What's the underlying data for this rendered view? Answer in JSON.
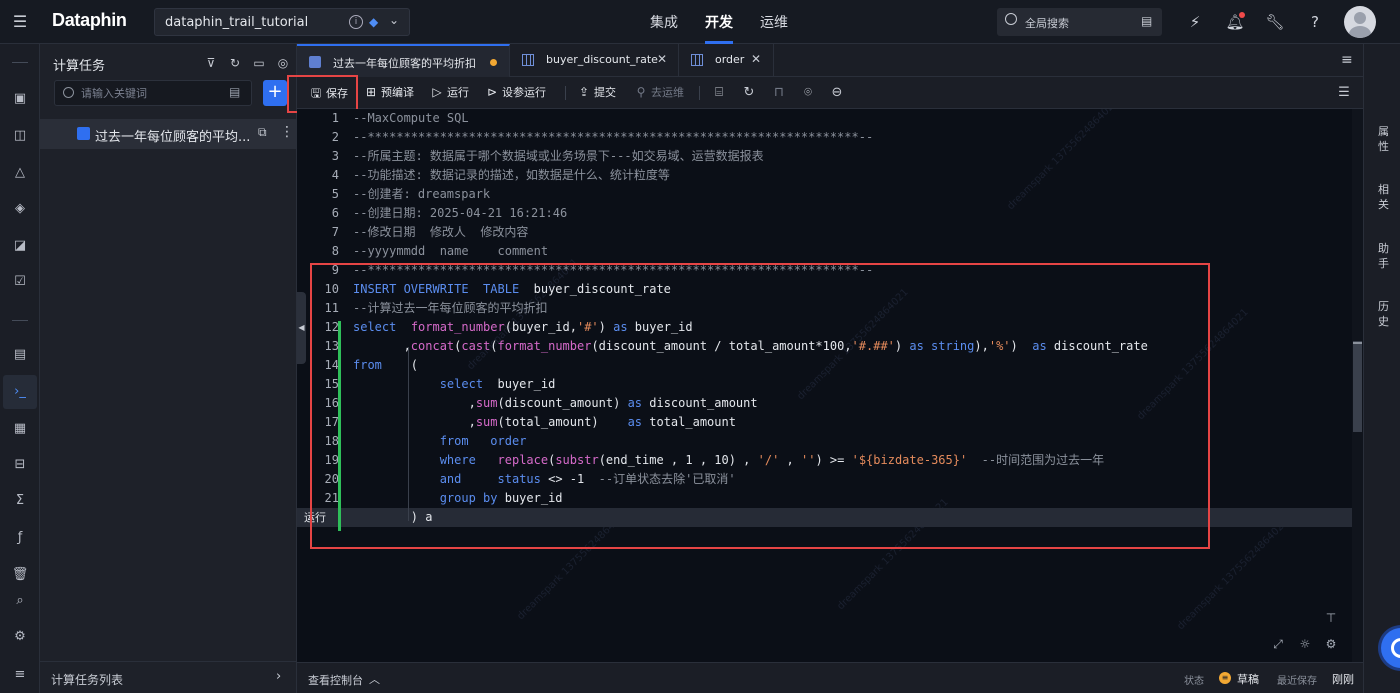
{
  "app": {
    "logo": "Dataphin",
    "project": "dataphin_trail_tutorial",
    "nav_tabs": [
      "集成",
      "开发",
      "运维"
    ],
    "active_nav": "开发",
    "global_search_placeholder": "全局搜索"
  },
  "task_panel": {
    "title": "计算任务",
    "search_placeholder": "请输入关键词",
    "task_item_label": "过去一年每位顾客的平均...",
    "footer_label": "计算任务列表"
  },
  "tabs": [
    {
      "label": "过去一年每位顾客的平均折扣",
      "icon": "sql-file-icon",
      "modified": true,
      "active": true
    },
    {
      "label": "buyer_discount_rate",
      "icon": "table-icon",
      "modified": false,
      "active": false
    },
    {
      "label": "order",
      "icon": "table-icon",
      "modified": false,
      "active": false
    }
  ],
  "toolbar": {
    "save": "保存",
    "precompile": "预编译",
    "run": "运行",
    "param_run": "设参运行",
    "submit": "提交",
    "to_ops": "去运维"
  },
  "editor": {
    "run_tag": "运行",
    "lines": [
      {
        "n": "1",
        "tokens": [
          {
            "c": "cm",
            "t": "--MaxCompute SQL"
          }
        ]
      },
      {
        "n": "2",
        "tokens": [
          {
            "c": "cm",
            "t": "--********************************************************************--"
          }
        ]
      },
      {
        "n": "3",
        "tokens": [
          {
            "c": "cm",
            "t": "--所属主题: 数据属于哪个数据域或业务场景下---如交易域、运营数据报表"
          }
        ]
      },
      {
        "n": "4",
        "tokens": [
          {
            "c": "cm",
            "t": "--功能描述: 数据记录的描述，如数据是什么、统计粒度等"
          }
        ]
      },
      {
        "n": "5",
        "tokens": [
          {
            "c": "cm",
            "t": "--创建者: dreamspark"
          }
        ]
      },
      {
        "n": "6",
        "tokens": [
          {
            "c": "cm",
            "t": "--创建日期: 2025-04-21 16:21:46"
          }
        ]
      },
      {
        "n": "7",
        "tokens": [
          {
            "c": "cm",
            "t": "--修改日期  修改人  修改内容"
          }
        ]
      },
      {
        "n": "8",
        "tokens": [
          {
            "c": "cm",
            "t": "--yyyymmdd  name    comment"
          }
        ]
      },
      {
        "n": "9",
        "tokens": [
          {
            "c": "cm",
            "t": "--********************************************************************--"
          }
        ]
      },
      {
        "n": "10",
        "tokens": [
          {
            "c": "kw",
            "t": "INSERT OVERWRITE  TABLE"
          },
          {
            "c": "tx",
            "t": "  buyer_discount_rate"
          }
        ]
      },
      {
        "n": "11",
        "tokens": [
          {
            "c": "cm",
            "t": "--计算过去一年每位顾客的平均折扣"
          }
        ]
      },
      {
        "n": "12",
        "tokens": [
          {
            "c": "kw",
            "t": "select"
          },
          {
            "c": "tx",
            "t": "  "
          },
          {
            "c": "fn",
            "t": "format_number"
          },
          {
            "c": "tx",
            "t": "(buyer_id,"
          },
          {
            "c": "st",
            "t": "'#'"
          },
          {
            "c": "tx",
            "t": ") "
          },
          {
            "c": "kw",
            "t": "as"
          },
          {
            "c": "tx",
            "t": " buyer_id"
          }
        ]
      },
      {
        "n": "13",
        "tokens": [
          {
            "c": "tx",
            "t": "       ,"
          },
          {
            "c": "fn",
            "t": "concat"
          },
          {
            "c": "tx",
            "t": "("
          },
          {
            "c": "fn",
            "t": "cast"
          },
          {
            "c": "tx",
            "t": "("
          },
          {
            "c": "fn",
            "t": "format_number"
          },
          {
            "c": "tx",
            "t": "(discount_amount / total_amount*100,"
          },
          {
            "c": "st",
            "t": "'#.##'"
          },
          {
            "c": "tx",
            "t": ") "
          },
          {
            "c": "kw",
            "t": "as string"
          },
          {
            "c": "tx",
            "t": "),"
          },
          {
            "c": "st",
            "t": "'%'"
          },
          {
            "c": "tx",
            "t": ")  "
          },
          {
            "c": "kw",
            "t": "as"
          },
          {
            "c": "tx",
            "t": " discount_rate"
          }
        ]
      },
      {
        "n": "14",
        "tokens": [
          {
            "c": "kw",
            "t": "from"
          },
          {
            "c": "tx",
            "t": "    ("
          }
        ]
      },
      {
        "n": "15",
        "tokens": [
          {
            "c": "tx",
            "t": "            "
          },
          {
            "c": "kw",
            "t": "select"
          },
          {
            "c": "tx",
            "t": "  buyer_id"
          }
        ]
      },
      {
        "n": "16",
        "tokens": [
          {
            "c": "tx",
            "t": "                ,"
          },
          {
            "c": "fn",
            "t": "sum"
          },
          {
            "c": "tx",
            "t": "(discount_amount) "
          },
          {
            "c": "kw",
            "t": "as"
          },
          {
            "c": "tx",
            "t": " discount_amount"
          }
        ]
      },
      {
        "n": "17",
        "tokens": [
          {
            "c": "tx",
            "t": "                ,"
          },
          {
            "c": "fn",
            "t": "sum"
          },
          {
            "c": "tx",
            "t": "(total_amount)    "
          },
          {
            "c": "kw",
            "t": "as"
          },
          {
            "c": "tx",
            "t": " total_amount"
          }
        ]
      },
      {
        "n": "18",
        "tokens": [
          {
            "c": "tx",
            "t": "            "
          },
          {
            "c": "kw",
            "t": "from"
          },
          {
            "c": "tx",
            "t": "   "
          },
          {
            "c": "kw",
            "t": "order"
          }
        ]
      },
      {
        "n": "19",
        "tokens": [
          {
            "c": "tx",
            "t": "            "
          },
          {
            "c": "kw",
            "t": "where"
          },
          {
            "c": "tx",
            "t": "   "
          },
          {
            "c": "fn",
            "t": "replace"
          },
          {
            "c": "tx",
            "t": "("
          },
          {
            "c": "fn",
            "t": "substr"
          },
          {
            "c": "tx",
            "t": "(end_time , 1 , 10) , "
          },
          {
            "c": "st",
            "t": "'/'"
          },
          {
            "c": "tx",
            "t": " , "
          },
          {
            "c": "st",
            "t": "''"
          },
          {
            "c": "tx",
            "t": ") >= "
          },
          {
            "c": "st",
            "t": "'${bizdate-365}'"
          },
          {
            "c": "cm",
            "t": "  --时间范围为过去一年"
          }
        ]
      },
      {
        "n": "20",
        "tokens": [
          {
            "c": "tx",
            "t": "            "
          },
          {
            "c": "kw",
            "t": "and"
          },
          {
            "c": "tx",
            "t": "     "
          },
          {
            "c": "kw",
            "t": "status"
          },
          {
            "c": "tx",
            "t": " <> -1  "
          },
          {
            "c": "cm",
            "t": "--订单状态去除'已取消'"
          }
        ]
      },
      {
        "n": "21",
        "tokens": [
          {
            "c": "tx",
            "t": "            "
          },
          {
            "c": "kw",
            "t": "group by"
          },
          {
            "c": "tx",
            "t": " buyer_id"
          }
        ]
      },
      {
        "n": "22",
        "tokens": [
          {
            "c": "tx",
            "t": "        ) a"
          }
        ]
      }
    ]
  },
  "right_rail": [
    "属性",
    "相关",
    "助手",
    "历史"
  ],
  "statusbar": {
    "console": "查看控制台",
    "status_label": "状态",
    "status_value": "草稿",
    "saved_label": "最近保存",
    "saved_value": "刚刚"
  },
  "watermark": [
    "dreamspark",
    "13755624864021"
  ],
  "colors": {
    "accent": "#2f6ff0",
    "highlight_box": "#e64545",
    "modified_dot": "#f2a833",
    "change_bar": "#2fbf5a"
  }
}
